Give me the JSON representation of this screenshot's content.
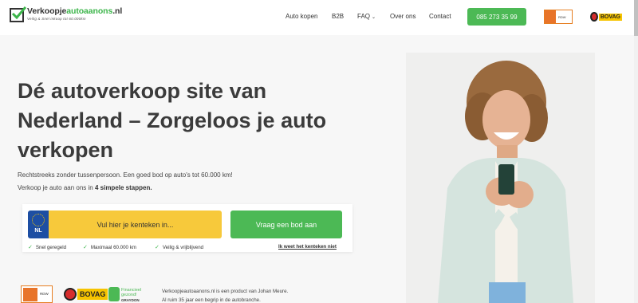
{
  "header": {
    "logo": {
      "name_main": "Verkoopje",
      "name_green": "autoaanons",
      "name_tld": ".nl",
      "tagline": "Veilig & Snel inkoop tot 60.000km"
    },
    "nav": [
      {
        "label": "Auto kopen"
      },
      {
        "label": "B2B"
      },
      {
        "label": "FAQ"
      },
      {
        "label": "Over ons"
      },
      {
        "label": "Contact"
      }
    ],
    "phone_button": "085 273 35 99",
    "badge_rdw": "RDW",
    "badge_bovag": "BOVAG"
  },
  "hero": {
    "title": "Dé autoverkoop site van Nederland – Zorgeloos je auto verkopen",
    "subtitle_line1": "Rechtstreeks zonder tussenpersoon. Een goed bod op auto's tot 60.000 km!",
    "subtitle_line2_prefix": "Verkoop je auto aan ons in ",
    "subtitle_line2_bold": "4 simpele stappen."
  },
  "form": {
    "plate_country": "NL",
    "plate_placeholder": "Vul hier je kenteken in...",
    "submit_label": "Vraag een bod aan",
    "usps": [
      "Snel geregeld",
      "Maximaal 60.000 km",
      "Veilig & vrijblijvend"
    ],
    "plate_unknown_link": "Ik weet het kenteken niet"
  },
  "trust": {
    "rdw": "RDW",
    "bovag": "BOVAG",
    "financial_title": "Financieel gezond!",
    "financial_sub": "GRAYDON",
    "about_line1": "Verkoopjeautoaanons.nl is een product van Johan Meure.",
    "about_line2": "Al ruim 35 jaar een begrip in de autobranche."
  },
  "colors": {
    "accent_green": "#4cb955",
    "plate_yellow": "#f7c93b",
    "eu_blue": "#1d4ea3",
    "title_text": "#3b3b3b"
  },
  "icons": [
    "checkbox-logo-icon",
    "chevron-down-icon",
    "check-icon",
    "eu-stars-icon"
  ]
}
